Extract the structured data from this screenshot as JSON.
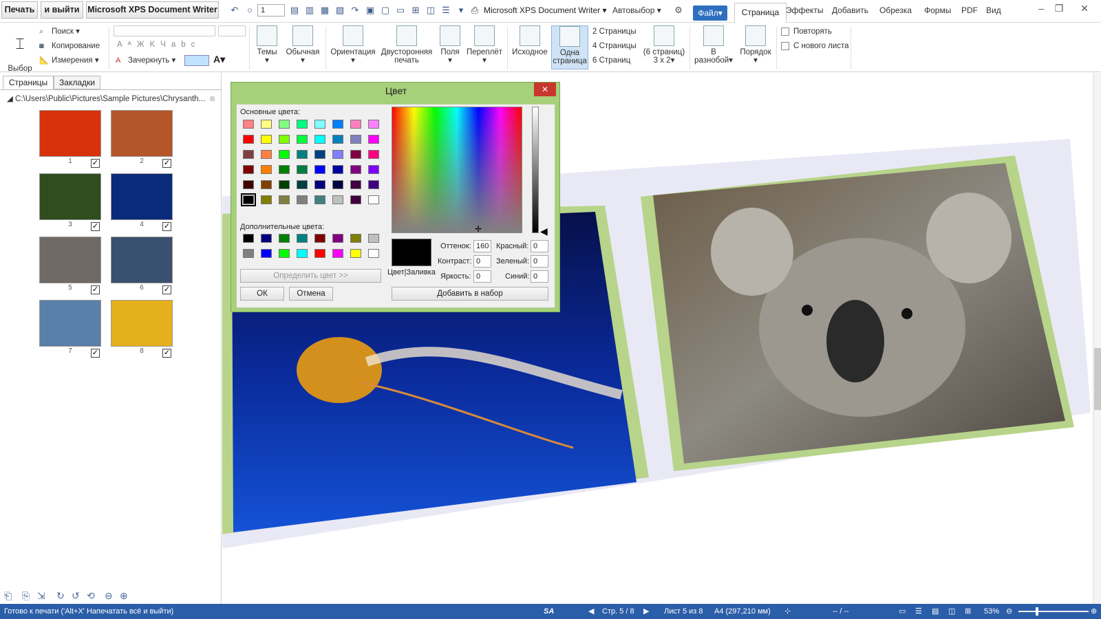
{
  "titlebar": {
    "print_btn": "Печать",
    "exit_btn": "и выйти",
    "printer_btn": "Microsoft XPS Document Writer",
    "page_field": "1",
    "printer_select": "Microsoft XPS Document Writer",
    "auto_select": "Автовыбор",
    "file_btn": "Файл",
    "tabs": [
      "Страница",
      "Эффекты",
      "Добавить",
      "Обрезка",
      "Формы",
      "PDF",
      "Вид"
    ]
  },
  "ribbon": {
    "select_text": "Выбор\nтекста",
    "search": "Поиск",
    "copy": "Копирование",
    "measure": "Измерения",
    "strike": "Зачеркнуть",
    "themes": "Темы",
    "normal": "Обычная",
    "orientation": "Ориентация",
    "duplex": "Двусторонняя\nпечать",
    "margins": "Поля",
    "binding": "Переплёт",
    "original": "Исходное",
    "one_page": "Одна\nстраница",
    "pages2": "2 Страницы",
    "pages4": "4 Страницы",
    "pages6": "6 Страниц",
    "grid6": "(6 страниц)\n3 x 2",
    "scatter": "В\nразнобой",
    "order": "Порядок",
    "repeat": "Повторять",
    "new_sheet": "С нового листа"
  },
  "leftpane": {
    "tab_pages": "Страницы",
    "tab_bookmarks": "Закладки",
    "path": "C:\\Users\\Public\\Pictures\\Sample Pictures\\Chrysanth...",
    "thumbs": [
      {
        "num": "1",
        "color": "#d8320c"
      },
      {
        "num": "2",
        "color": "#b5562a"
      },
      {
        "num": "3",
        "color": "#2f4d1e"
      },
      {
        "num": "4",
        "color": "#0a2a7a"
      },
      {
        "num": "5",
        "color": "#6f6a63"
      },
      {
        "num": "6",
        "color": "#3a5070"
      },
      {
        "num": "7",
        "color": "#5a7fa8"
      },
      {
        "num": "8",
        "color": "#e4b01c"
      }
    ]
  },
  "dialog": {
    "title": "Цвет",
    "basic_label": "Основные цвета:",
    "custom_label": "Дополнительные цвета:",
    "define_btn": "Определить цвет >>",
    "ok": "ОК",
    "cancel": "Отмена",
    "add_btn": "Добавить в набор",
    "color_fill": "Цвет|Заливка",
    "hue_label": "Оттенок:",
    "hue": "160",
    "sat_label": "Контраст:",
    "sat": "0",
    "lum_label": "Яркость:",
    "lum": "0",
    "red_label": "Красный:",
    "red": "0",
    "green_label": "Зеленый:",
    "green": "0",
    "blue_label": "Синий:",
    "blue": "0",
    "basic_colors": [
      "#ff8080",
      "#ffff80",
      "#80ff80",
      "#00ff80",
      "#80ffff",
      "#0080ff",
      "#ff80c0",
      "#ff80ff",
      "#ff0000",
      "#ffff00",
      "#80ff00",
      "#00ff40",
      "#00ffff",
      "#0080c0",
      "#8080c0",
      "#ff00ff",
      "#804040",
      "#ff8040",
      "#00ff00",
      "#008080",
      "#004080",
      "#8080ff",
      "#800040",
      "#ff0080",
      "#800000",
      "#ff8000",
      "#008000",
      "#008040",
      "#0000ff",
      "#0000a0",
      "#800080",
      "#8000ff",
      "#400000",
      "#804000",
      "#004000",
      "#004040",
      "#000080",
      "#000040",
      "#400040",
      "#400080",
      "#000000",
      "#808000",
      "#808040",
      "#808080",
      "#408080",
      "#c0c0c0",
      "#400040",
      "#ffffff"
    ],
    "custom_colors": [
      "#000000",
      "#000080",
      "#008000",
      "#008080",
      "#800000",
      "#800080",
      "#808000",
      "#c0c0c0",
      "#808080",
      "#0000ff",
      "#00ff00",
      "#00ffff",
      "#ff0000",
      "#ff00ff",
      "#ffff00",
      "#ffffff"
    ]
  },
  "status": {
    "ready": "Готово к печати ('Alt+X' Напечатать всё и выйти)",
    "page": "Стр. 5 / 8",
    "sheet": "Лист 5 из 8",
    "size": "A4 (297,210 мм)",
    "dash": "-- / --",
    "zoom": "53%"
  },
  "colors": {
    "accent": "#2b5ea8",
    "dialog_frame": "#a6d07a",
    "page_border": "#b7d48a"
  }
}
